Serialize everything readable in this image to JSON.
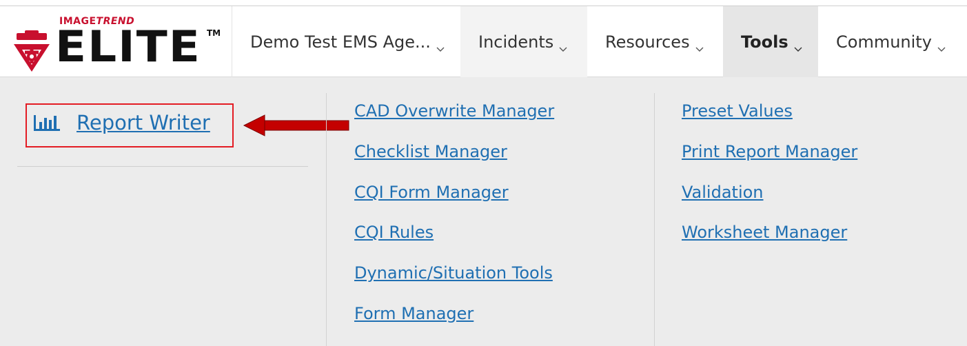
{
  "brand": {
    "top_left": "IMAGE",
    "top_right": "TREND",
    "name": "ELITE",
    "trademark": "TM"
  },
  "nav": {
    "agency": "Demo Test EMS Age...",
    "incidents": "Incidents",
    "resources": "Resources",
    "tools": "Tools",
    "community": "Community"
  },
  "menu": {
    "featured": {
      "label": "Report Writer",
      "icon": "bar-chart-icon"
    },
    "col2": [
      "CAD Overwrite Manager",
      "Checklist Manager",
      "CQI Form Manager",
      "CQI Rules",
      "Dynamic/Situation Tools",
      "Form Manager"
    ],
    "col3": [
      "Preset Values",
      "Print Report Manager",
      "Validation",
      "Worksheet Manager"
    ]
  },
  "colors": {
    "link": "#1f6fb2",
    "highlight_box": "#e31b23",
    "arrow": "#cc0000",
    "brand_red": "#c8102e"
  }
}
